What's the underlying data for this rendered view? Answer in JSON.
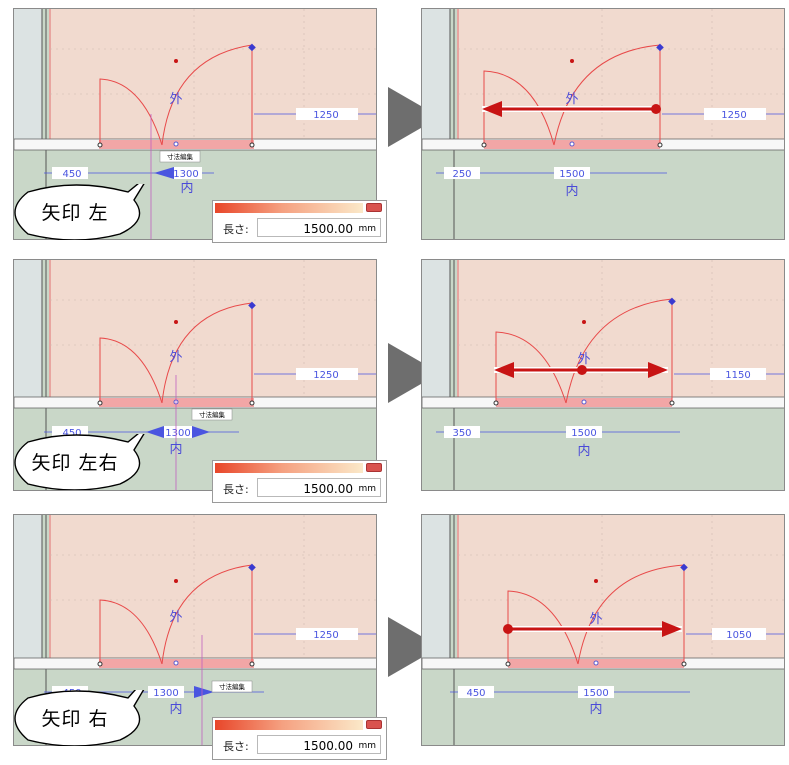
{
  "rows": [
    {
      "callout_label": "矢印 左",
      "before": {
        "dim_left": "450",
        "dim_center": "1300",
        "dim_right": "1250",
        "zone_out": "外",
        "zone_in": "内",
        "edit_tag": "寸法編集"
      },
      "after": {
        "dim_left": "250",
        "dim_center": "1500",
        "dim_right": "1250",
        "zone_out": "外",
        "zone_in": "内",
        "arrow_direction": "left"
      },
      "dialog": {
        "label": "長さ:",
        "value": "1500.00",
        "unit": "mm"
      }
    },
    {
      "callout_label": "矢印 左右",
      "before": {
        "dim_left": "450",
        "dim_center": "1300",
        "dim_right": "1250",
        "zone_out": "外",
        "zone_in": "内",
        "edit_tag": "寸法編集"
      },
      "after": {
        "dim_left": "350",
        "dim_center": "1500",
        "dim_right": "1150",
        "zone_out": "外",
        "zone_in": "内",
        "arrow_direction": "both"
      },
      "dialog": {
        "label": "長さ:",
        "value": "1500.00",
        "unit": "mm"
      }
    },
    {
      "callout_label": "矢印 右",
      "before": {
        "dim_left": "450",
        "dim_center": "1300",
        "dim_right": "1250",
        "zone_out": "外",
        "zone_in": "内",
        "edit_tag": "寸法編集"
      },
      "after": {
        "dim_left": "450",
        "dim_center": "1500",
        "dim_right": "1050",
        "zone_out": "外",
        "zone_in": "内",
        "arrow_direction": "right"
      },
      "dialog": {
        "label": "長さ:",
        "value": "1500.00",
        "unit": "mm"
      }
    }
  ],
  "colors": {
    "outer_zone": "#f1dacf",
    "inner_zone": "#c9d7c8",
    "wall_band": "#f2a6a6",
    "dimension": "#4a55e0",
    "door_line": "#e84a4a",
    "arrow": "#c81414"
  }
}
